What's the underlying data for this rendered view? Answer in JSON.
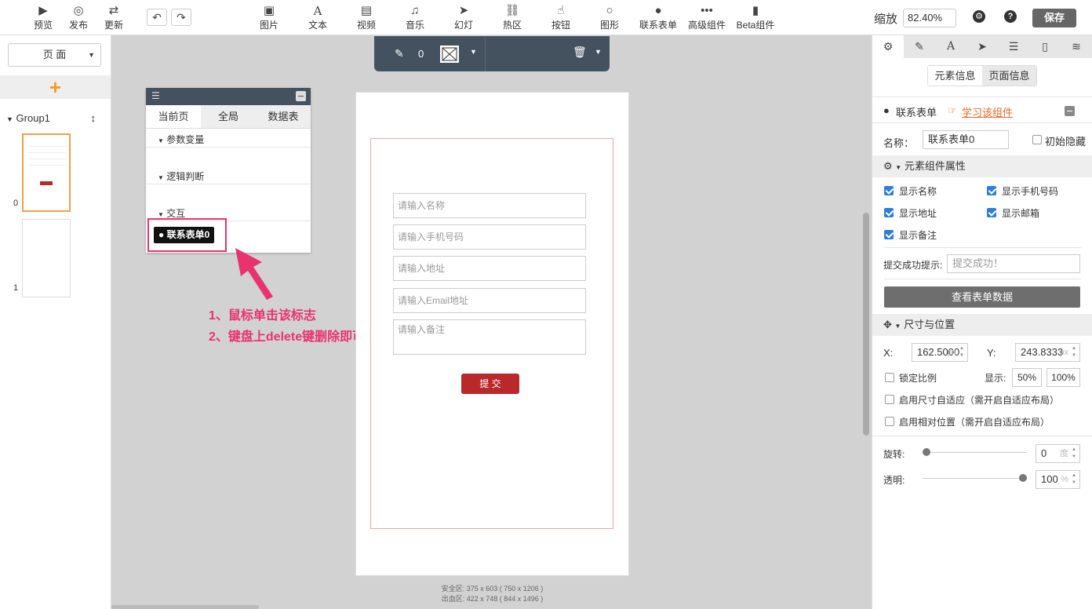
{
  "toolbar": {
    "preview": "预览",
    "publish": "发布",
    "update": "更新",
    "image": "图片",
    "text": "文本",
    "video": "视频",
    "music": "音乐",
    "slides": "幻灯",
    "hotspot": "热区",
    "button": "按钮",
    "shape": "图形",
    "contact_form": "联系表单",
    "advanced": "高级组件",
    "beta": "Beta组件",
    "zoom_label": "缩放",
    "zoom_value": "82.40%",
    "save": "保存"
  },
  "left": {
    "page_select": "页 面",
    "add": "+",
    "group_name": "Group1",
    "thumbs": [
      {
        "num": "0"
      },
      {
        "num": "1"
      }
    ]
  },
  "logic_panel": {
    "tabs": [
      "当前页",
      "全局",
      "数据表"
    ],
    "sections": [
      "参数变量",
      "逻辑判断",
      "交互"
    ],
    "chip": "联系表单0"
  },
  "annotation": {
    "line1": "1、鼠标单击该标志",
    "line2": "2、键盘上delete键删除即可",
    "color": "#e8336f"
  },
  "edit_bar": {
    "count": "0"
  },
  "canvas": {
    "fields": [
      "请输入名称",
      "请输入手机号码",
      "请输入地址",
      "请输入Email地址",
      "请输入备注"
    ],
    "submit": "提 交",
    "safe_zone": "安全区: 375 x 603 ( 750 x 1206 )",
    "bleed_zone": "出血区: 422 x 748 ( 844 x 1496 )"
  },
  "right": {
    "seg": [
      "元素信息",
      "页面信息"
    ],
    "component_title": "联系表单",
    "learn_link": "学习该组件",
    "name_label": "名称：",
    "name_value": "联系表单0",
    "hidden_label": "初始隐藏",
    "props_title": "元素组件属性",
    "options": [
      {
        "label": "显示名称",
        "checked": true
      },
      {
        "label": "显示手机号码",
        "checked": true
      },
      {
        "label": "显示地址",
        "checked": true
      },
      {
        "label": "显示邮箱",
        "checked": true
      },
      {
        "label": "显示备注",
        "checked": true
      }
    ],
    "success_label": "提交成功提示:",
    "success_value": "提交成功！",
    "view_data": "查看表单数据",
    "size_pos_title": "尺寸与位置",
    "x_label": "X:",
    "x_value": "162.5000",
    "y_label": "Y:",
    "y_value": "243.8333",
    "px": "px",
    "lock_ratio": "锁定比例",
    "display_label": "显示:",
    "display_50": "50%",
    "display_100": "100%",
    "auto_size": "启用尺寸自适应（需开启自适应布局）",
    "relative_pos": "启用相对位置（需开启自适应布局）",
    "rotate_label": "旋转:",
    "rotate_value": "0",
    "rotate_unit": "度",
    "rotate_fraction": 0,
    "opacity_label": "透明:",
    "opacity_value": "100",
    "opacity_unit": "%",
    "opacity_fraction": 1
  }
}
